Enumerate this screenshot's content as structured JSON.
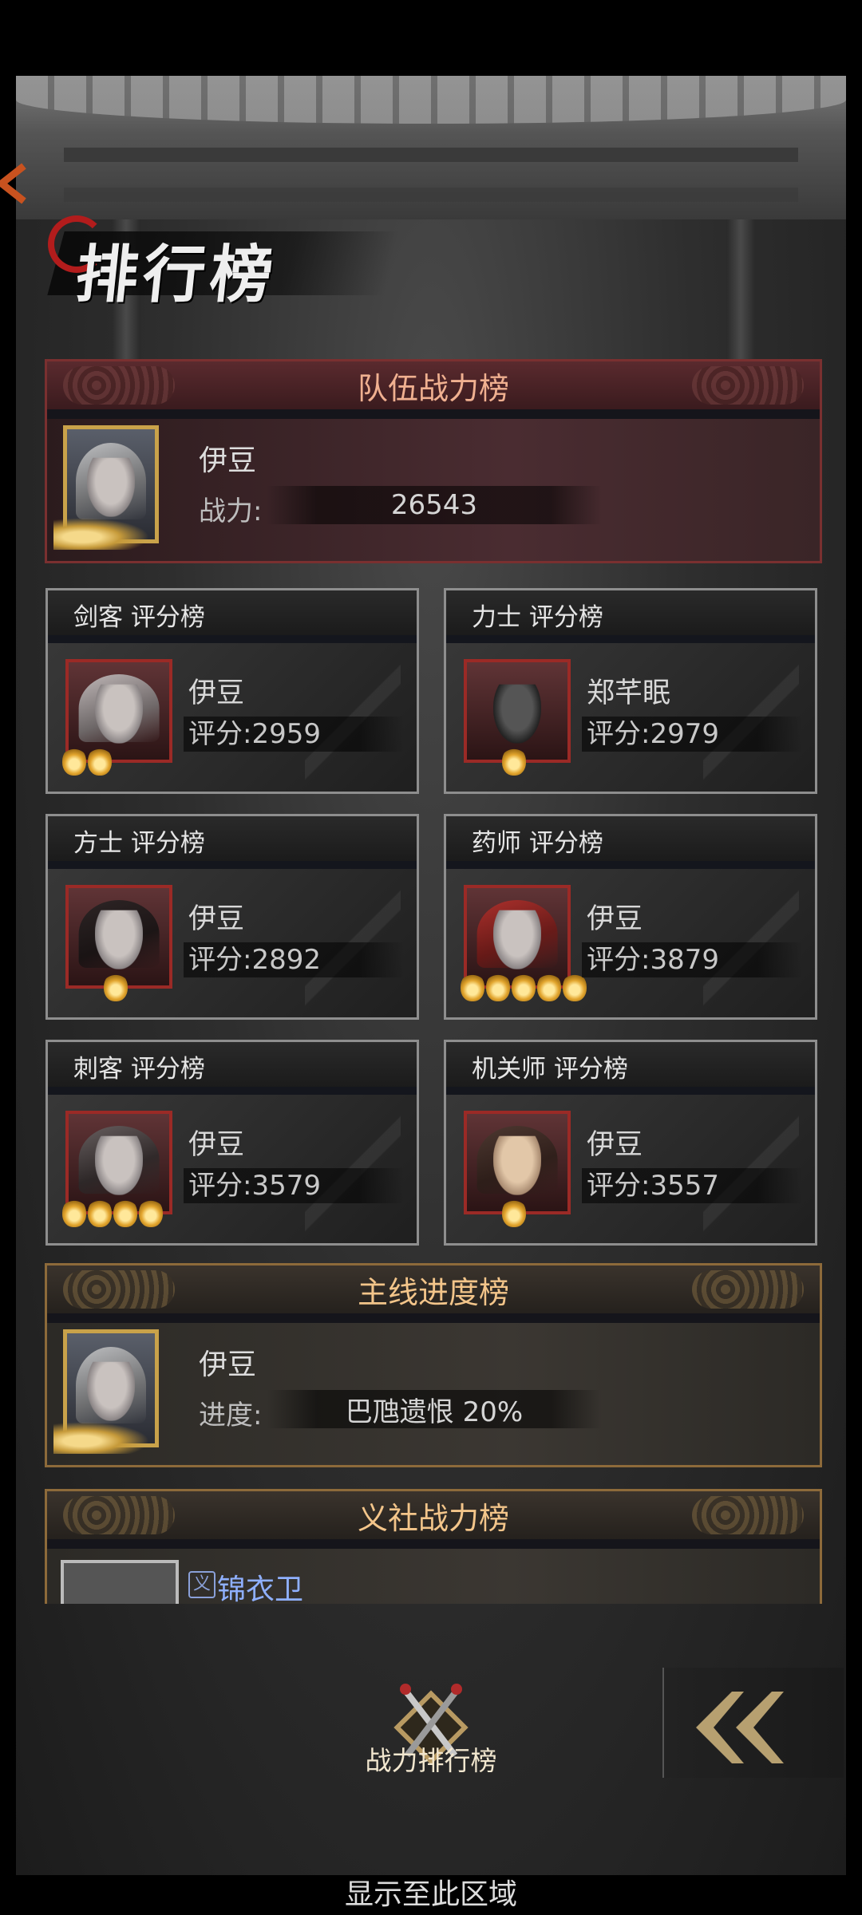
{
  "screen": {
    "title": "排行榜",
    "footer_hint": "显示至此区域"
  },
  "team_power": {
    "title": "队伍战力榜",
    "name": "伊豆",
    "label": "战力:",
    "value": "26543"
  },
  "class_boards": [
    {
      "title": "剑客 评分榜",
      "name": "伊豆",
      "score": "评分:2959",
      "stars": 2
    },
    {
      "title": "力士 评分榜",
      "name": "郑芊眠",
      "score": "评分:2979",
      "stars": 1
    },
    {
      "title": "方士 评分榜",
      "name": "伊豆",
      "score": "评分:2892",
      "stars": 1
    },
    {
      "title": "药师 评分榜",
      "name": "伊豆",
      "score": "评分:3879",
      "stars": 5
    },
    {
      "title": "刺客 评分榜",
      "name": "伊豆",
      "score": "评分:3579",
      "stars": 4
    },
    {
      "title": "机关师 评分榜",
      "name": "伊豆",
      "score": "评分:3557",
      "stars": 1
    }
  ],
  "story_progress": {
    "title": "主线进度榜",
    "name": "伊豆",
    "label": "进度:",
    "value": "巴虺遗恨  20%"
  },
  "guild_power": {
    "title": "义社战力榜",
    "tag": "义",
    "name": "锦衣卫"
  },
  "bottom_nav": {
    "active_tab_label": "战力排行榜",
    "back_icon": "double-chevron-left-icon"
  },
  "colors": {
    "team_header_text": "#f0b090",
    "story_header_text": "#f3c58a",
    "guild_name": "#8fb0ff",
    "star_gold": "#e2a52e"
  }
}
